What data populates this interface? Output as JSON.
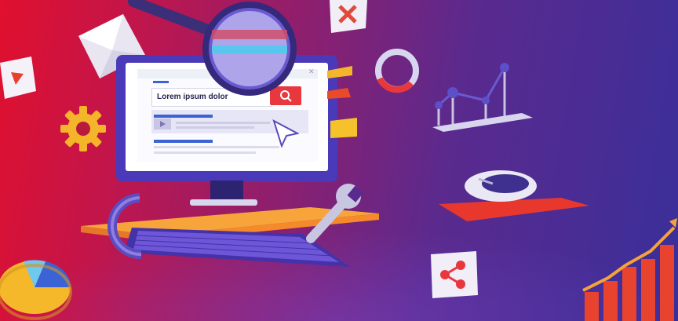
{
  "search": {
    "query": "Lorem ipsum dolor"
  },
  "colors": {
    "bg_left": "#e0102e",
    "bg_right": "#3a2f9a",
    "accent_orange": "#f58a2a",
    "accent_red": "#e8383d",
    "link_blue": "#3b63d6",
    "folder_yellow": "#f6c22b"
  },
  "icons": [
    "envelope-icon",
    "play-icon",
    "gear-icon",
    "close-icon",
    "magnifier-icon",
    "ring-icon",
    "line-chart-icon",
    "mouse-icon",
    "wrench-icon",
    "share-icon",
    "pie-chart-icon",
    "bar-chart-icon"
  ]
}
